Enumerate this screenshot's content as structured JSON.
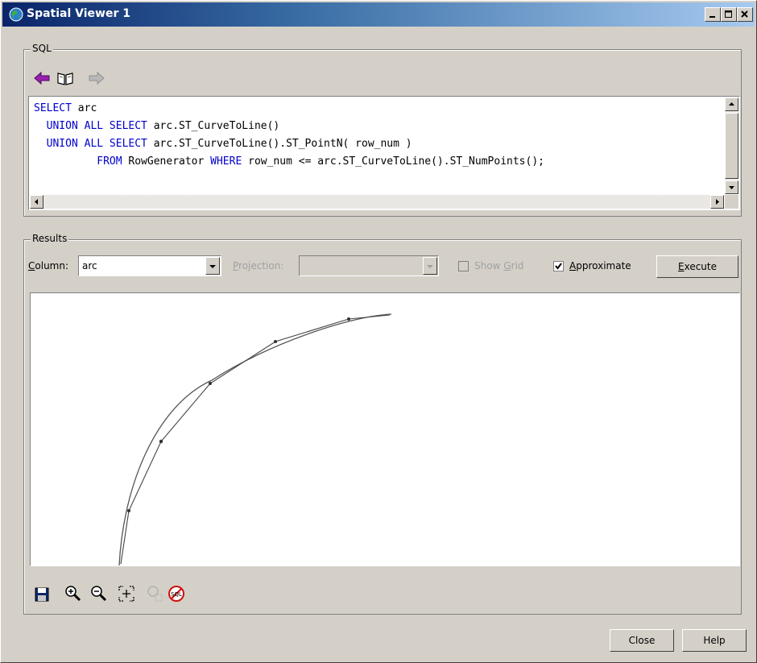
{
  "window": {
    "title": "Spatial Viewer 1"
  },
  "sql": {
    "group_label": "SQL",
    "lines": [
      [
        {
          "t": "SELECT",
          "k": true
        },
        {
          "t": " arc",
          "k": false
        }
      ],
      [
        {
          "t": "  UNION ALL SELECT",
          "k": true
        },
        {
          "t": " arc.ST_CurveToLine()",
          "k": false
        }
      ],
      [
        {
          "t": "  UNION ALL SELECT",
          "k": true
        },
        {
          "t": " arc.ST_CurveToLine().ST_PointN( row_num )",
          "k": false
        }
      ],
      [
        {
          "t": "          FROM",
          "k": true
        },
        {
          "t": " RowGenerator ",
          "k": false
        },
        {
          "t": "WHERE",
          "k": true
        },
        {
          "t": " row_num <= arc.ST_CurveToLine().ST_NumPoints();",
          "k": false
        }
      ]
    ]
  },
  "results": {
    "group_label": "Results",
    "column_label": "Column:",
    "column_value": "arc",
    "projection_label": "Projection:",
    "projection_value": "",
    "show_grid_label": "Show Grid",
    "show_grid_checked": false,
    "approximate_label": "Approximate",
    "approximate_checked": true,
    "execute_label": "Execute"
  },
  "toolbar_icons": [
    "save-icon",
    "zoom-in-icon",
    "zoom-out-icon",
    "zoom-fit-icon",
    "zoom-selection-icon",
    "clear-sql-icon"
  ],
  "footer": {
    "close_label": "Close",
    "help_label": "Help"
  },
  "colors": {
    "keyword": "#0000cc",
    "title_bar": "#0a246a",
    "window_bg": "#d4d0c8"
  }
}
